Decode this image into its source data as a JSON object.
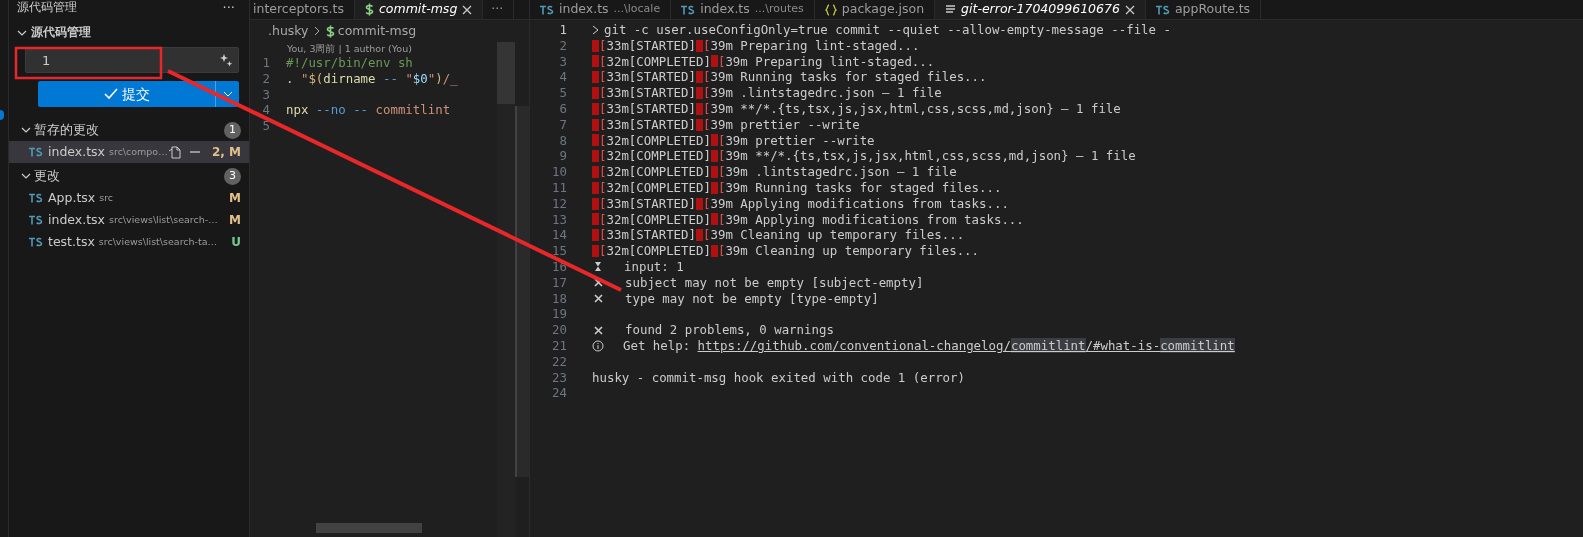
{
  "sidebar": {
    "title": "源代码管理",
    "more": "···",
    "section": {
      "label": "源代码管理",
      "expanded": true
    },
    "message_input": {
      "value": "1"
    },
    "commit_button": {
      "label": "提交"
    },
    "groups": [
      {
        "label": "暂存的更改",
        "count": "1",
        "expanded": true,
        "files": [
          {
            "name": "index.tsx",
            "path": "src\\compo…",
            "status": "2, M",
            "color": "#e2c08d",
            "selected": true
          }
        ]
      },
      {
        "label": "更改",
        "count": "3",
        "expanded": true,
        "files": [
          {
            "name": "App.tsx",
            "path": "src",
            "status": "M",
            "color": "#e2c08d",
            "selected": false
          },
          {
            "name": "index.tsx",
            "path": "src\\views\\list\\search-…",
            "status": "M",
            "color": "#e2c08d",
            "selected": false
          },
          {
            "name": "test.tsx",
            "path": "src\\views\\list\\search-ta…",
            "status": "U",
            "color": "#73c991",
            "selected": false
          }
        ]
      }
    ]
  },
  "left_editor": {
    "tabs": [
      {
        "label": "interceptors.ts",
        "kind": "plain",
        "selected": false,
        "preview": false
      },
      {
        "label": "commit-msg",
        "kind": "shell",
        "selected": true,
        "preview": true
      }
    ],
    "more": "···",
    "breadcrumb": [
      {
        "label": ".husky",
        "kind": "plain"
      },
      {
        "label": "commit-msg",
        "kind": "shell"
      }
    ],
    "blame": "You, 3周前 | 1 author (You)",
    "lines": [
      {
        "number": "1",
        "tokens": [
          {
            "kind": "comment",
            "text": "#!/usr/bin/env sh"
          }
        ]
      },
      {
        "number": "2",
        "tokens": [
          {
            "kind": "plain",
            "text": ". "
          },
          {
            "kind": "string",
            "text": "\""
          },
          {
            "kind": "punct",
            "text": "$("
          },
          {
            "kind": "func",
            "text": "dirname"
          },
          {
            "kind": "keyword",
            "text": " -- "
          },
          {
            "kind": "string",
            "text": "\""
          },
          {
            "kind": "var",
            "text": "$0"
          },
          {
            "kind": "string",
            "text": "\""
          },
          {
            "kind": "punct",
            "text": ")"
          },
          {
            "kind": "string",
            "text": "/_"
          }
        ]
      },
      {
        "number": "3"
      },
      {
        "number": "4",
        "tokens": [
          {
            "kind": "func",
            "text": "npx"
          },
          {
            "kind": "keyword",
            "text": " --no -- "
          },
          {
            "kind": "string",
            "text": "commitlint"
          }
        ]
      },
      {
        "number": "5"
      }
    ]
  },
  "right_editor": {
    "tabs": [
      {
        "label": "index.ts",
        "detail": "...\\locale",
        "kind": "ts",
        "selected": false,
        "preview": false
      },
      {
        "label": "index.ts",
        "detail": "...\\routes",
        "kind": "ts",
        "selected": false,
        "preview": false
      },
      {
        "label": "package.json",
        "kind": "json",
        "selected": false,
        "preview": false
      },
      {
        "label": "git-error-1704099610676",
        "kind": "text",
        "selected": true,
        "preview": true
      },
      {
        "label": "appRoute.ts",
        "kind": "ts",
        "selected": false,
        "preview": false
      }
    ],
    "lines": [
      {
        "number": "1",
        "segments": [
          {
            "kind": "cursor"
          },
          {
            "kind": "text",
            "text": "git -c user.useConfigOnly=true commit --quiet --allow-empty-message --file -"
          }
        ]
      },
      {
        "number": "2",
        "segments": [
          {
            "kind": "esc",
            "text": "["
          },
          {
            "kind": "text",
            "text": "33m[STARTED]"
          },
          {
            "kind": "esc",
            "text": "["
          },
          {
            "kind": "text",
            "text": "39m Preparing lint-staged..."
          }
        ]
      },
      {
        "number": "3",
        "segments": [
          {
            "kind": "esc",
            "text": "["
          },
          {
            "kind": "text",
            "text": "32m[COMPLETED]"
          },
          {
            "kind": "esc",
            "text": "["
          },
          {
            "kind": "text",
            "text": "39m Preparing lint-staged..."
          }
        ]
      },
      {
        "number": "4",
        "segments": [
          {
            "kind": "esc",
            "text": "["
          },
          {
            "kind": "text",
            "text": "33m[STARTED]"
          },
          {
            "kind": "esc",
            "text": "["
          },
          {
            "kind": "text",
            "text": "39m Running tasks for staged files..."
          }
        ]
      },
      {
        "number": "5",
        "segments": [
          {
            "kind": "esc",
            "text": "["
          },
          {
            "kind": "text",
            "text": "33m[STARTED]"
          },
          {
            "kind": "esc",
            "text": "["
          },
          {
            "kind": "text",
            "text": "39m .lintstagedrc.json — 1 file"
          }
        ]
      },
      {
        "number": "6",
        "segments": [
          {
            "kind": "esc",
            "text": "["
          },
          {
            "kind": "text",
            "text": "33m[STARTED]"
          },
          {
            "kind": "esc",
            "text": "["
          },
          {
            "kind": "text",
            "text": "39m **/*.{ts,tsx,js,jsx,html,css,scss,md,json} — 1 file"
          }
        ]
      },
      {
        "number": "7",
        "segments": [
          {
            "kind": "esc",
            "text": "["
          },
          {
            "kind": "text",
            "text": "33m[STARTED]"
          },
          {
            "kind": "esc",
            "text": "["
          },
          {
            "kind": "text",
            "text": "39m prettier --write"
          }
        ]
      },
      {
        "number": "8",
        "segments": [
          {
            "kind": "esc",
            "text": "["
          },
          {
            "kind": "text",
            "text": "32m[COMPLETED]"
          },
          {
            "kind": "esc",
            "text": "["
          },
          {
            "kind": "text",
            "text": "39m prettier --write"
          }
        ]
      },
      {
        "number": "9",
        "segments": [
          {
            "kind": "esc",
            "text": "["
          },
          {
            "kind": "text",
            "text": "32m[COMPLETED]"
          },
          {
            "kind": "esc",
            "text": "["
          },
          {
            "kind": "text",
            "text": "39m **/*.{ts,tsx,js,jsx,html,css,scss,md,json} — 1 file"
          }
        ]
      },
      {
        "number": "10",
        "segments": [
          {
            "kind": "esc",
            "text": "["
          },
          {
            "kind": "text",
            "text": "32m[COMPLETED]"
          },
          {
            "kind": "esc",
            "text": "["
          },
          {
            "kind": "text",
            "text": "39m .lintstagedrc.json — 1 file"
          }
        ]
      },
      {
        "number": "11",
        "segments": [
          {
            "kind": "esc",
            "text": "["
          },
          {
            "kind": "text",
            "text": "32m[COMPLETED]"
          },
          {
            "kind": "esc",
            "text": "["
          },
          {
            "kind": "text",
            "text": "39m Running tasks for staged files..."
          }
        ]
      },
      {
        "number": "12",
        "segments": [
          {
            "kind": "esc",
            "text": "["
          },
          {
            "kind": "text",
            "text": "33m[STARTED]"
          },
          {
            "kind": "esc",
            "text": "["
          },
          {
            "kind": "text",
            "text": "39m Applying modifications from tasks..."
          }
        ]
      },
      {
        "number": "13",
        "segments": [
          {
            "kind": "esc",
            "text": "["
          },
          {
            "kind": "text",
            "text": "32m[COMPLETED]"
          },
          {
            "kind": "esc",
            "text": "["
          },
          {
            "kind": "text",
            "text": "39m Applying modifications from tasks..."
          }
        ]
      },
      {
        "number": "14",
        "segments": [
          {
            "kind": "esc",
            "text": "["
          },
          {
            "kind": "text",
            "text": "33m[STARTED]"
          },
          {
            "kind": "esc",
            "text": "["
          },
          {
            "kind": "text",
            "text": "39m Cleaning up temporary files..."
          }
        ]
      },
      {
        "number": "15",
        "segments": [
          {
            "kind": "esc",
            "text": "["
          },
          {
            "kind": "text",
            "text": "32m[COMPLETED]"
          },
          {
            "kind": "esc",
            "text": "["
          },
          {
            "kind": "text",
            "text": "39m Cleaning up temporary files..."
          }
        ]
      },
      {
        "number": "16",
        "segments": [
          {
            "kind": "hourglass"
          },
          {
            "kind": "text",
            "text": "input: 1"
          }
        ]
      },
      {
        "number": "17",
        "segments": [
          {
            "kind": "cross"
          },
          {
            "kind": "text",
            "text": "subject may not be empty [subject-empty]"
          }
        ]
      },
      {
        "number": "18",
        "segments": [
          {
            "kind": "cross"
          },
          {
            "kind": "text",
            "text": "type may not be empty [type-empty]"
          }
        ]
      },
      {
        "number": "19"
      },
      {
        "number": "20",
        "segments": [
          {
            "kind": "cross"
          },
          {
            "kind": "text",
            "text": "found 2 problems, 0 warnings"
          }
        ]
      },
      {
        "number": "21",
        "segments": [
          {
            "kind": "info"
          },
          {
            "kind": "text",
            "text": "Get help: "
          },
          {
            "kind": "link",
            "parts": [
              {
                "text": "https://github.com/conventional-changelog/",
                "highlight": false
              },
              {
                "text": "commitlint",
                "highlight": true
              },
              {
                "text": "/#what-is-",
                "highlight": false
              },
              {
                "text": "commitlint",
                "highlight": true
              }
            ]
          }
        ]
      },
      {
        "number": "22"
      },
      {
        "number": "23",
        "segments": [
          {
            "kind": "text",
            "text": "husky - commit-msg hook exited with code 1 (error)"
          }
        ]
      },
      {
        "number": "24"
      }
    ]
  }
}
